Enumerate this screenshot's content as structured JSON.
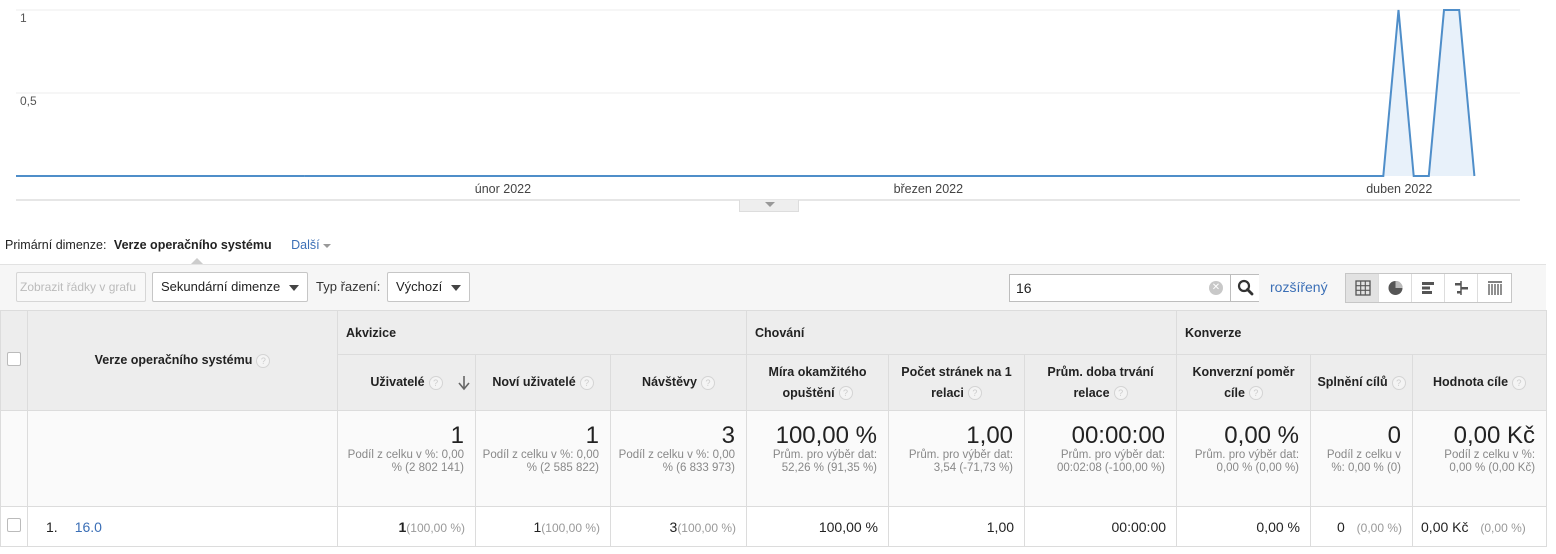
{
  "chart_data": {
    "type": "area",
    "y_ticks": [
      "1",
      "0,5"
    ],
    "x_labels": [
      "únor 2022",
      "březen 2022",
      "duben 2022"
    ],
    "ylim": [
      0,
      1
    ],
    "line_color": "#4f8ec9",
    "fill_color": "#e8f1fa",
    "series": [
      {
        "points": [
          [
            "2022-01-20",
            0
          ],
          [
            "2022-04-01",
            0
          ],
          [
            "2022-04-02",
            1
          ],
          [
            "2022-04-03",
            0
          ],
          [
            "2022-04-04",
            0
          ],
          [
            "2022-04-05",
            1
          ],
          [
            "2022-04-06",
            1
          ],
          [
            "2022-04-07",
            0
          ]
        ]
      }
    ]
  },
  "primary_dimension": {
    "label": "Primární dimenze:",
    "value": "Verze operačního systému",
    "more": "Další"
  },
  "toolbar": {
    "plot_rows": "Zobrazit řádky v grafu",
    "secondary_dimension": "Sekundární dimenze",
    "sort_label": "Typ řazení:",
    "sort_value": "Výchozí",
    "search_value": "16",
    "advanced": "rozšířený"
  },
  "table": {
    "dimension_header": "Verze operačního systému",
    "groups": [
      "Akvizice",
      "Chování",
      "Konverze"
    ],
    "columns": [
      "Uživatelé",
      "Noví uživatelé",
      "Návštěvy",
      "Míra okamžitého opuštění",
      "Počet stránek na 1 relaci",
      "Prům. doba trvání relace",
      "Konverzní poměr cíle",
      "Splnění cílů",
      "Hodnota cíle"
    ],
    "totals": [
      {
        "value": "1",
        "sub": "Podíl z celku v %: 0,00 % (2 802 141)"
      },
      {
        "value": "1",
        "sub": "Podíl z celku v %: 0,00 % (2 585 822)"
      },
      {
        "value": "3",
        "sub": "Podíl z celku v %: 0,00 % (6 833 973)"
      },
      {
        "value": "100,00 %",
        "sub": "Prům. pro výběr dat: 52,26 % (91,35 %)"
      },
      {
        "value": "1,00",
        "sub": "Prům. pro výběr dat: 3,54 (-71,73 %)"
      },
      {
        "value": "00:00:00",
        "sub": "Prům. pro výběr dat: 00:02:08 (-100,00 %)"
      },
      {
        "value": "0,00 %",
        "sub": "Prům. pro výběr dat: 0,00 % (0,00 %)"
      },
      {
        "value": "0",
        "sub": "Podíl z celku v %: 0,00 % (0)"
      },
      {
        "value": "0,00 Kč",
        "sub": "Podíl z celku v %: 0,00 % (0,00 Kč)"
      }
    ],
    "rows": [
      {
        "index": "1.",
        "dimension": "16.0",
        "cells": [
          {
            "value": "1",
            "pct": "(100,00 %)"
          },
          {
            "value": "1",
            "pct": "(100,00 %)"
          },
          {
            "value": "3",
            "pct": "(100,00 %)"
          },
          {
            "value": "100,00 %",
            "pct": ""
          },
          {
            "value": "1,00",
            "pct": ""
          },
          {
            "value": "00:00:00",
            "pct": ""
          },
          {
            "value": "0,00 %",
            "pct": ""
          },
          {
            "value": "0",
            "pct": "(0,00 %)"
          },
          {
            "value": "0,00 Kč",
            "pct": "(0,00 %)"
          }
        ]
      }
    ]
  }
}
